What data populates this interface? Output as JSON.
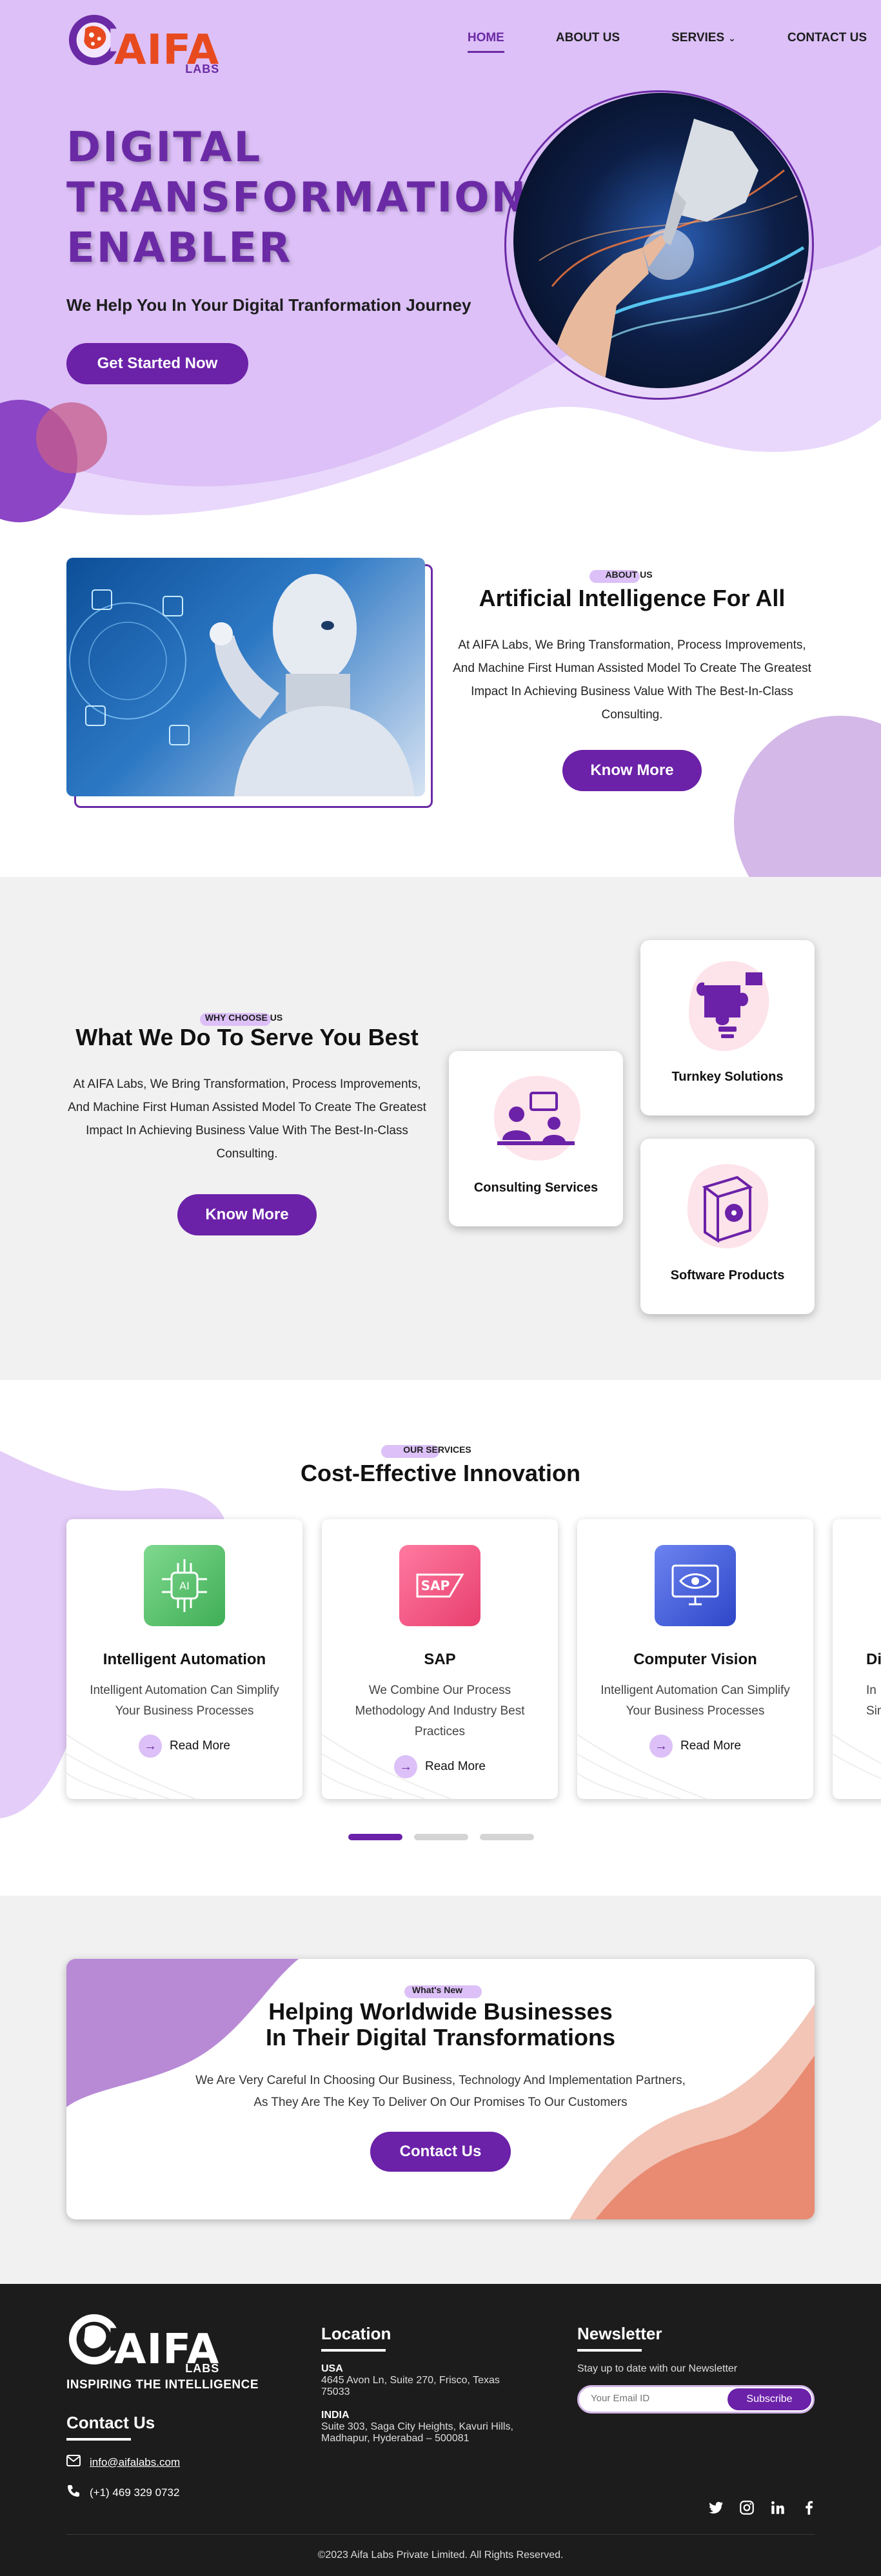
{
  "colors": {
    "primary": "#6b21a8",
    "lavender": "#dcc0f7",
    "brand_orange": "#e84a1f",
    "footer_bg": "#1c1c1c"
  },
  "header": {
    "logo_text": "AIFA",
    "logo_sub": "LABS",
    "nav": [
      {
        "label": "HOME",
        "active": true
      },
      {
        "label": "ABOUT US",
        "active": false
      },
      {
        "label": "SERVIES",
        "active": false
      },
      {
        "label": "CONTACT US",
        "active": false
      }
    ]
  },
  "hero": {
    "title_line1": "DIGITAL",
    "title_line2": "TRANSFORMATION",
    "title_line3": "ENABLER",
    "subtitle": "We Help You In Your Digital Tranformation Journey",
    "cta": "Get Started Now"
  },
  "about": {
    "tag": "ABOUT US",
    "title": "Artificial Intelligence For All",
    "body": "At AIFA Labs, We Bring Transformation, Process Improvements, And Machine First Human Assisted Model To Create The Greatest Impact In Achieving Business Value With The Best-In-Class Consulting.",
    "cta": "Know More"
  },
  "why": {
    "tag": "WHY CHOOSE US",
    "title": "What We Do To Serve You Best",
    "body": "At AIFA Labs, We Bring Transformation, Process Improvements, And Machine First Human Assisted Model To Create The Greatest Impact In Achieving Business Value With The Best-In-Class Consulting.",
    "cta": "Know More",
    "cards": [
      {
        "label": "Turnkey Solutions",
        "icon": "puzzle-bulb-icon"
      },
      {
        "label": "Consulting Services",
        "icon": "consulting-people-icon"
      },
      {
        "label": "Software Products",
        "icon": "software-box-icon"
      }
    ]
  },
  "services": {
    "tag": "OUR SERVICES",
    "title": "Cost-Effective Innovation",
    "cards": [
      {
        "title": "Intelligent Automation",
        "desc": "Intelligent Automation Can Simplify Your Business Processes",
        "link": "Read More",
        "icon": "ai-chip-icon",
        "color": "#5bc26e"
      },
      {
        "title": "SAP",
        "desc": "We Combine Our Process Methodology And Industry Best Practices",
        "link": "Read More",
        "icon": "sap-logo-icon",
        "color": "#f0507a"
      },
      {
        "title": "Computer Vision",
        "desc": "Intelligent Automation Can Simplify Your Business Processes",
        "link": "Read More",
        "icon": "monitor-eye-icon",
        "color": "#3f5bd8"
      },
      {
        "title": "Di",
        "desc": "In Simpl",
        "link": "",
        "icon": "partial-card-icon",
        "color": "#888888"
      }
    ],
    "slider_pages": 3,
    "slider_active": 1
  },
  "news": {
    "tag": "What's New",
    "title_line1": "Helping Worldwide Businesses",
    "title_line2": "In Their Digital Transformations",
    "body_line1": "We Are Very Careful In Choosing Our Business, Technology And Implementation Partners,",
    "body_line2": "As They Are The Key To Deliver On Our Promises To Our Customers",
    "cta": "Contact Us"
  },
  "footer": {
    "logo_text": "AIFA",
    "logo_sub": "LABS",
    "tagline": "INSPIRING THE INTELLIGENCE",
    "contact_heading": "Contact Us",
    "email": "info@aifalabs.com",
    "phone": "(+1) 469 329 0732",
    "location_heading": "Location",
    "usa_label": "USA",
    "usa_address": "4645 Avon Ln, Suite 270, Frisco, Texas 75033",
    "india_label": "INDIA",
    "india_address": "Suite 303, Saga City Heights, Kavuri Hills, Madhapur, Hyderabad – 500081",
    "newsletter_heading": "Newsletter",
    "newsletter_sub": "Stay up to date with our Newsletter",
    "email_placeholder": "Your Email ID",
    "subscribe": "Subscribe",
    "social": [
      "twitter-icon",
      "instagram-icon",
      "linkedin-icon",
      "facebook-icon"
    ],
    "copyright": "©2023 Aifa Labs Private Limited. All Rights Reserved."
  }
}
